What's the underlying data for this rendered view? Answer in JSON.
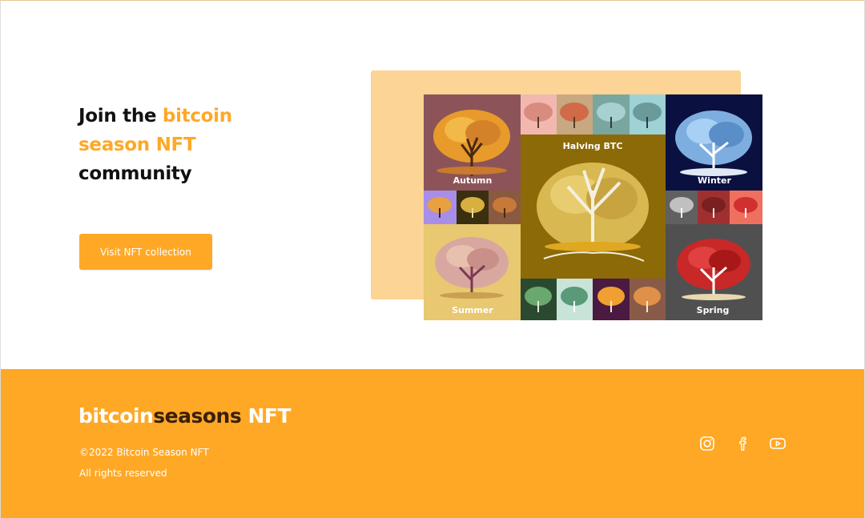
{
  "hero": {
    "title_part1": "Join the ",
    "title_accent": "bitcoin season NFT",
    "title_part2": " community",
    "cta_label": "Visit NFT collection"
  },
  "collage": {
    "labels": {
      "autumn": "Autumn",
      "halving": "Halving BTC",
      "winter": "Winter",
      "summer": "Summer",
      "spring": "Spring"
    }
  },
  "footer": {
    "brand_part1": "bitcoin",
    "brand_part2": "seasons",
    "brand_part3": " NFT",
    "copyright": "©2022 Bitcoin Season NFT",
    "rights": "All rights reserved",
    "social_icons": [
      "instagram-icon",
      "facebook-icon",
      "youtube-icon"
    ]
  },
  "colors": {
    "accent": "#ffa826",
    "backplate": "#fbd496",
    "brand_dark": "#3a1f0a"
  }
}
